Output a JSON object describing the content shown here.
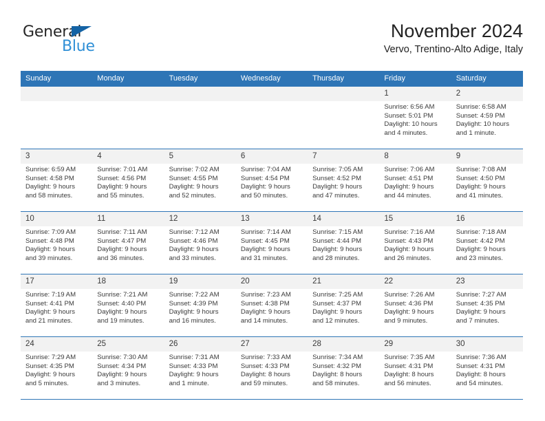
{
  "logo": {
    "word1": "General",
    "word2": "Blue",
    "triangle_color": "#1463a5",
    "word2_color": "#2f8fd6"
  },
  "header": {
    "title": "November 2024",
    "subtitle": "Vervo, Trentino-Alto Adige, Italy"
  },
  "theme": {
    "header_bg": "#2e75b6",
    "daynum_bg": "#f2f2f2",
    "row_border": "#2e75b6",
    "text": "#3a3a3a"
  },
  "weekdays": [
    "Sunday",
    "Monday",
    "Tuesday",
    "Wednesday",
    "Thursday",
    "Friday",
    "Saturday"
  ],
  "weeks": [
    [
      {
        "empty": true
      },
      {
        "empty": true
      },
      {
        "empty": true
      },
      {
        "empty": true
      },
      {
        "empty": true
      },
      {
        "day": "1",
        "sunrise": "Sunrise: 6:56 AM",
        "sunset": "Sunset: 5:01 PM",
        "daylight1": "Daylight: 10 hours",
        "daylight2": "and 4 minutes."
      },
      {
        "day": "2",
        "sunrise": "Sunrise: 6:58 AM",
        "sunset": "Sunset: 4:59 PM",
        "daylight1": "Daylight: 10 hours",
        "daylight2": "and 1 minute."
      }
    ],
    [
      {
        "day": "3",
        "sunrise": "Sunrise: 6:59 AM",
        "sunset": "Sunset: 4:58 PM",
        "daylight1": "Daylight: 9 hours",
        "daylight2": "and 58 minutes."
      },
      {
        "day": "4",
        "sunrise": "Sunrise: 7:01 AM",
        "sunset": "Sunset: 4:56 PM",
        "daylight1": "Daylight: 9 hours",
        "daylight2": "and 55 minutes."
      },
      {
        "day": "5",
        "sunrise": "Sunrise: 7:02 AM",
        "sunset": "Sunset: 4:55 PM",
        "daylight1": "Daylight: 9 hours",
        "daylight2": "and 52 minutes."
      },
      {
        "day": "6",
        "sunrise": "Sunrise: 7:04 AM",
        "sunset": "Sunset: 4:54 PM",
        "daylight1": "Daylight: 9 hours",
        "daylight2": "and 50 minutes."
      },
      {
        "day": "7",
        "sunrise": "Sunrise: 7:05 AM",
        "sunset": "Sunset: 4:52 PM",
        "daylight1": "Daylight: 9 hours",
        "daylight2": "and 47 minutes."
      },
      {
        "day": "8",
        "sunrise": "Sunrise: 7:06 AM",
        "sunset": "Sunset: 4:51 PM",
        "daylight1": "Daylight: 9 hours",
        "daylight2": "and 44 minutes."
      },
      {
        "day": "9",
        "sunrise": "Sunrise: 7:08 AM",
        "sunset": "Sunset: 4:50 PM",
        "daylight1": "Daylight: 9 hours",
        "daylight2": "and 41 minutes."
      }
    ],
    [
      {
        "day": "10",
        "sunrise": "Sunrise: 7:09 AM",
        "sunset": "Sunset: 4:48 PM",
        "daylight1": "Daylight: 9 hours",
        "daylight2": "and 39 minutes."
      },
      {
        "day": "11",
        "sunrise": "Sunrise: 7:11 AM",
        "sunset": "Sunset: 4:47 PM",
        "daylight1": "Daylight: 9 hours",
        "daylight2": "and 36 minutes."
      },
      {
        "day": "12",
        "sunrise": "Sunrise: 7:12 AM",
        "sunset": "Sunset: 4:46 PM",
        "daylight1": "Daylight: 9 hours",
        "daylight2": "and 33 minutes."
      },
      {
        "day": "13",
        "sunrise": "Sunrise: 7:14 AM",
        "sunset": "Sunset: 4:45 PM",
        "daylight1": "Daylight: 9 hours",
        "daylight2": "and 31 minutes."
      },
      {
        "day": "14",
        "sunrise": "Sunrise: 7:15 AM",
        "sunset": "Sunset: 4:44 PM",
        "daylight1": "Daylight: 9 hours",
        "daylight2": "and 28 minutes."
      },
      {
        "day": "15",
        "sunrise": "Sunrise: 7:16 AM",
        "sunset": "Sunset: 4:43 PM",
        "daylight1": "Daylight: 9 hours",
        "daylight2": "and 26 minutes."
      },
      {
        "day": "16",
        "sunrise": "Sunrise: 7:18 AM",
        "sunset": "Sunset: 4:42 PM",
        "daylight1": "Daylight: 9 hours",
        "daylight2": "and 23 minutes."
      }
    ],
    [
      {
        "day": "17",
        "sunrise": "Sunrise: 7:19 AM",
        "sunset": "Sunset: 4:41 PM",
        "daylight1": "Daylight: 9 hours",
        "daylight2": "and 21 minutes."
      },
      {
        "day": "18",
        "sunrise": "Sunrise: 7:21 AM",
        "sunset": "Sunset: 4:40 PM",
        "daylight1": "Daylight: 9 hours",
        "daylight2": "and 19 minutes."
      },
      {
        "day": "19",
        "sunrise": "Sunrise: 7:22 AM",
        "sunset": "Sunset: 4:39 PM",
        "daylight1": "Daylight: 9 hours",
        "daylight2": "and 16 minutes."
      },
      {
        "day": "20",
        "sunrise": "Sunrise: 7:23 AM",
        "sunset": "Sunset: 4:38 PM",
        "daylight1": "Daylight: 9 hours",
        "daylight2": "and 14 minutes."
      },
      {
        "day": "21",
        "sunrise": "Sunrise: 7:25 AM",
        "sunset": "Sunset: 4:37 PM",
        "daylight1": "Daylight: 9 hours",
        "daylight2": "and 12 minutes."
      },
      {
        "day": "22",
        "sunrise": "Sunrise: 7:26 AM",
        "sunset": "Sunset: 4:36 PM",
        "daylight1": "Daylight: 9 hours",
        "daylight2": "and 9 minutes."
      },
      {
        "day": "23",
        "sunrise": "Sunrise: 7:27 AM",
        "sunset": "Sunset: 4:35 PM",
        "daylight1": "Daylight: 9 hours",
        "daylight2": "and 7 minutes."
      }
    ],
    [
      {
        "day": "24",
        "sunrise": "Sunrise: 7:29 AM",
        "sunset": "Sunset: 4:35 PM",
        "daylight1": "Daylight: 9 hours",
        "daylight2": "and 5 minutes."
      },
      {
        "day": "25",
        "sunrise": "Sunrise: 7:30 AM",
        "sunset": "Sunset: 4:34 PM",
        "daylight1": "Daylight: 9 hours",
        "daylight2": "and 3 minutes."
      },
      {
        "day": "26",
        "sunrise": "Sunrise: 7:31 AM",
        "sunset": "Sunset: 4:33 PM",
        "daylight1": "Daylight: 9 hours",
        "daylight2": "and 1 minute."
      },
      {
        "day": "27",
        "sunrise": "Sunrise: 7:33 AM",
        "sunset": "Sunset: 4:33 PM",
        "daylight1": "Daylight: 8 hours",
        "daylight2": "and 59 minutes."
      },
      {
        "day": "28",
        "sunrise": "Sunrise: 7:34 AM",
        "sunset": "Sunset: 4:32 PM",
        "daylight1": "Daylight: 8 hours",
        "daylight2": "and 58 minutes."
      },
      {
        "day": "29",
        "sunrise": "Sunrise: 7:35 AM",
        "sunset": "Sunset: 4:31 PM",
        "daylight1": "Daylight: 8 hours",
        "daylight2": "and 56 minutes."
      },
      {
        "day": "30",
        "sunrise": "Sunrise: 7:36 AM",
        "sunset": "Sunset: 4:31 PM",
        "daylight1": "Daylight: 8 hours",
        "daylight2": "and 54 minutes."
      }
    ]
  ]
}
